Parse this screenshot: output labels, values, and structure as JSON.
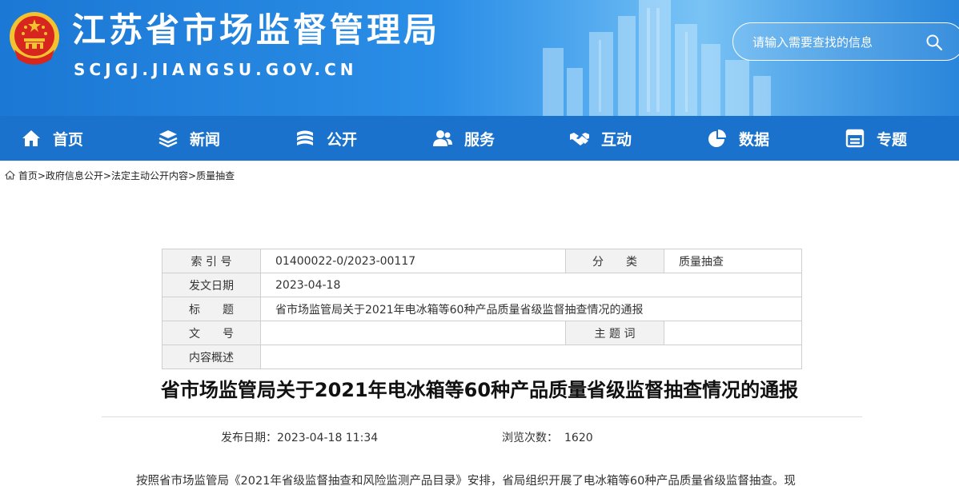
{
  "header": {
    "site_title": "江苏省市场监督管理局",
    "site_domain": "SCJGJ.JIANGSU.GOV.CN",
    "search_placeholder": "请输入需要查找的信息"
  },
  "nav": {
    "items": [
      {
        "label": "首页",
        "icon": "home-icon"
      },
      {
        "label": "新闻",
        "icon": "layers-icon"
      },
      {
        "label": "公开",
        "icon": "document-stack-icon"
      },
      {
        "label": "服务",
        "icon": "users-icon"
      },
      {
        "label": "互动",
        "icon": "handshake-icon"
      },
      {
        "label": "数据",
        "icon": "pie-chart-icon"
      },
      {
        "label": "专题",
        "icon": "window-icon"
      }
    ]
  },
  "breadcrumb": {
    "items": [
      "首页",
      "政府信息公开",
      "法定主动公开内容",
      "质量抽查"
    ],
    "separator": ">"
  },
  "info_table": {
    "index_label": "索 引 号",
    "index_value": "01400022-0/2023-00117",
    "category_label": "分　　类",
    "category_value": "质量抽查",
    "date_label": "发文日期",
    "date_value": "2023-04-18",
    "title_label": "标　　题",
    "title_value": "省市场监管局关于2021年电冰箱等60种产品质量省级监督抽查情况的通报",
    "docno_label": "文　　号",
    "docno_value": "",
    "keyword_label": "主 题 词",
    "keyword_value": "",
    "summary_label": "内容概述",
    "summary_value": ""
  },
  "article": {
    "title": "省市场监管局关于2021年电冰箱等60种产品质量省级监督抽查情况的通报",
    "publish_label": "发布日期：",
    "publish_value": "2023-04-18 11:34",
    "views_label": "浏览次数：",
    "views_value": "1620",
    "first_paragraph": "按照省市场监管局《2021年省级监督抽查和风险监测产品目录》安排，省局组织开展了电冰箱等60种产品质量省级监督抽查。现"
  },
  "colors": {
    "header_blue": "#1b78d4",
    "nav_blue": "#1a72cc",
    "emblem_red": "#d7261e",
    "emblem_gold": "#f2c230"
  }
}
